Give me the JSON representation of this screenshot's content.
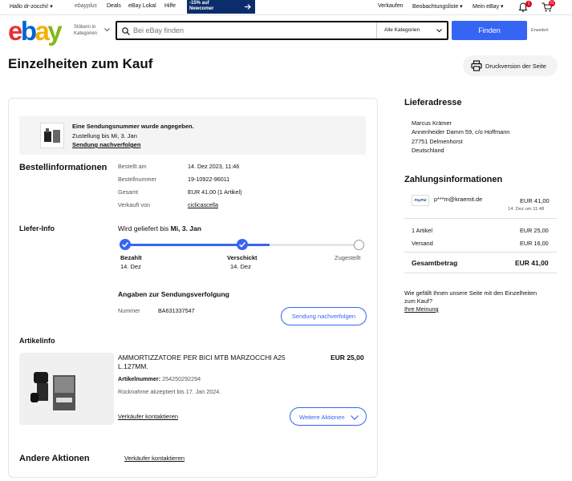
{
  "topbar": {
    "greeting": "Hallo dr-zocchi!",
    "ebayplus": "ebayplus",
    "deals": "Deals",
    "ebay_lokal": "eBay Lokal",
    "hilfe": "Hilfe",
    "promo_line1": "-15% auf",
    "promo_line2": "Newcomer",
    "verkaufen": "Verkaufen",
    "beobachtungsliste": "Beobachtungsliste",
    "mein_ebay": "Mein eBay",
    "notif_count": "1",
    "cart_count": "22"
  },
  "header": {
    "logo": {
      "e": "e",
      "b": "b",
      "a": "a",
      "y": "y"
    },
    "browse_line1": "Stöbern in",
    "browse_line2": "Kategorien",
    "search_placeholder": "Bei eBay finden",
    "category": "Alle Kategorien",
    "search_button": "Finden",
    "advanced": "Erweitert"
  },
  "page": {
    "title": "Einzelheiten zum Kauf",
    "print_button": "Druckversion der Seite"
  },
  "notice": {
    "line1": "Eine Sendungsnummer wurde angegeben.",
    "line2": "Zustellung bis Mi, 3. Jan",
    "link": "Sendung nachverfolgen"
  },
  "order_info": {
    "heading": "Bestellinformationen",
    "rows": [
      {
        "label": "Bestellt am",
        "value": "14. Dez 2023, 11:46"
      },
      {
        "label": "Bestellnummer",
        "value": "19-10922-96011"
      },
      {
        "label": "Gesamt",
        "value": "EUR 41,00 (1 Artikel)"
      },
      {
        "label": "Verkauft von",
        "value": "ciclicascella"
      }
    ]
  },
  "delivery": {
    "heading": "Liefer-Info",
    "expected_prefix": "Wird geliefert bis ",
    "expected_date": "Mi, 3. Jan",
    "progress": 0.62,
    "steps": [
      {
        "label": "Bezahlt",
        "date": "14. Dez"
      },
      {
        "label": "Verschickt",
        "date": "14. Dez"
      },
      {
        "label": "Zugestellt",
        "date": ""
      }
    ],
    "tracking_heading": "Angaben zur Sendungsverfolgung",
    "number_label": "Nummer",
    "number_value": "BA631337547",
    "track_button": "Sendung nachverfolgen"
  },
  "item": {
    "heading": "Artikelinfo",
    "title_line1": "AMMORTIZZATORE PER BICI MTB MARZOCCHI A25",
    "title_line2": "L.127MM.",
    "price": "EUR 25,00",
    "article_label": "Artikelnummer:",
    "article_number": "254250292294",
    "return_note": "Rücknahme akzeptiert bis 17. Jan 2024.",
    "contact_seller": "Verkäufer kontaktieren",
    "more_actions": "Weitere Aktionen"
  },
  "other_actions": {
    "heading": "Andere Aktionen",
    "contact_seller": "Verkäufer kontaktieren"
  },
  "address": {
    "heading": "Lieferadresse",
    "lines": [
      "Marcus Krämer",
      "Annenheider Damm 59, c/o Hoffmann",
      "27751 Delmenhorst",
      "Deutschland"
    ]
  },
  "payment": {
    "heading": "Zahlungsinformationen",
    "method_logo": "PayPal",
    "account": "p***m@kraemit.de",
    "amount": "EUR 41,00",
    "date": "14. Dez um 11:48",
    "items_label": "1 Artikel",
    "items_value": "EUR 25,00",
    "shipping_label": "Versand",
    "shipping_value": "EUR 16,00",
    "total_label": "Gesamtbetrag",
    "total_value": "EUR 41,00"
  },
  "feedback": {
    "question_line1": "Wie gefällt Ihnen unsere Seite mit den Einzelheiten",
    "question_line2": "zum Kauf?",
    "link": "Ihre Meinung"
  },
  "colors": {
    "accent": "#3665f3",
    "promo": "#0c2d6b",
    "badge": "#e0001b"
  }
}
